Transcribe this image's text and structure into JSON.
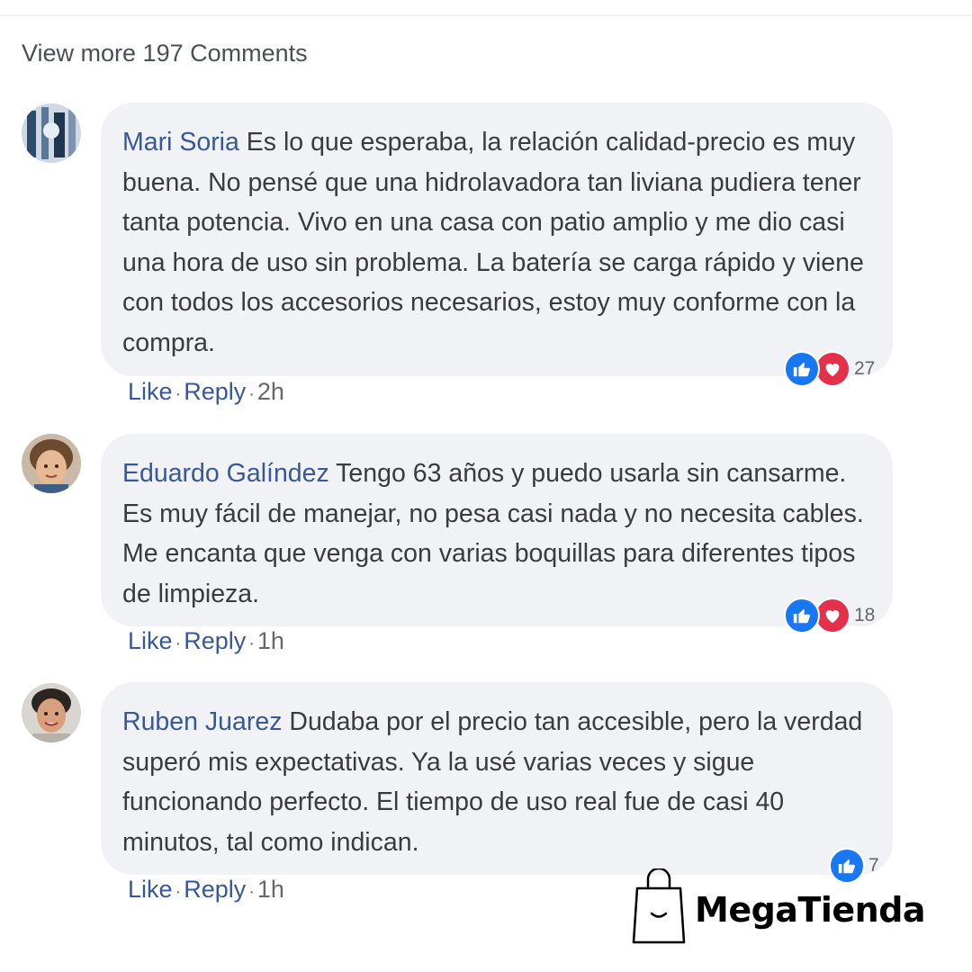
{
  "view_more": "View more 197 Comments",
  "comments": [
    {
      "author": "Mari Soria",
      "text": "Es lo que esperaba, la relación calidad-precio es muy buena. No pensé que una hidrolavadora tan liviana pudiera tener tanta potencia. Vivo en una casa con patio amplio y me dio casi una hora de uso sin problema. La batería se carga rápido y viene con todos los accesorios necesarios, estoy muy conforme con la compra.",
      "reactions": [
        "like-icon",
        "love-icon"
      ],
      "reaction_count": "27",
      "like_label": "Like",
      "reply_label": "Reply",
      "separator": "·",
      "time": "2h"
    },
    {
      "author": "Eduardo Galíndez",
      "text": "Tengo 63 años y puedo usarla sin cansarme. Es muy fácil de manejar, no pesa casi nada y no necesita cables. Me encanta que venga con varias boquillas para diferentes tipos de limpieza.",
      "reactions": [
        "like-icon",
        "love-icon"
      ],
      "reaction_count": "18",
      "like_label": "Like",
      "reply_label": "Reply",
      "separator": "·",
      "time": "1h"
    },
    {
      "author": "Ruben Juarez",
      "text": "Dudaba por el precio tan accesible, pero la verdad superó mis expectativas. Ya la usé varias veces y sigue funcionando perfecto. El tiempo de uso real fue de casi 40 minutos, tal como indican.",
      "reactions": [
        "like-icon"
      ],
      "reaction_count": "7",
      "like_label": "Like",
      "reply_label": "Reply",
      "separator": "·",
      "time": "1h"
    }
  ],
  "brand": {
    "name": "MegaTienda"
  },
  "colors": {
    "link": "#385898",
    "bubble": "#f0f2f5",
    "like": "#1877f2",
    "love": "#e4314b"
  }
}
